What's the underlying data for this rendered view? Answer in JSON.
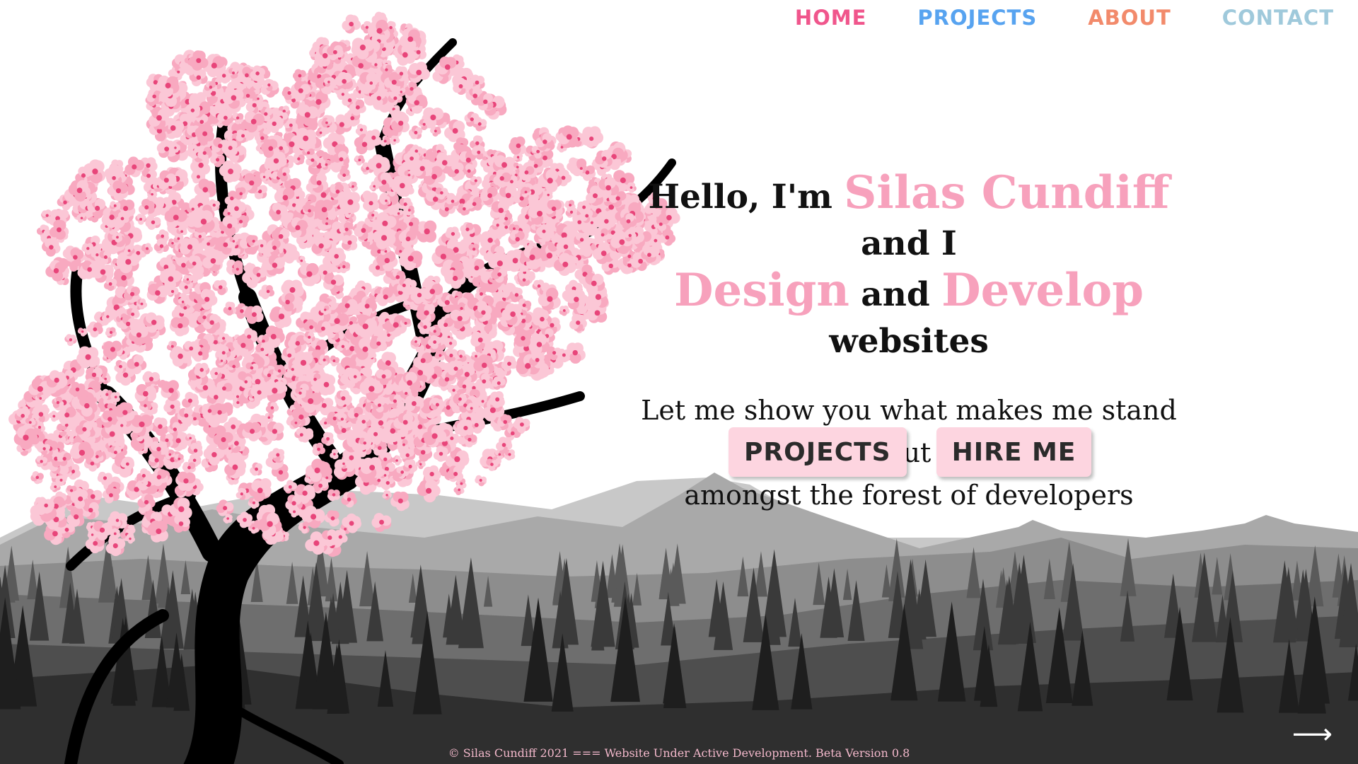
{
  "nav": {
    "items": [
      {
        "label": "HOME",
        "color": "#f0568c"
      },
      {
        "label": "PROJECTS",
        "color": "#57a3f0"
      },
      {
        "label": "ABOUT",
        "color": "#f28a6b"
      },
      {
        "label": "CONTACT",
        "color": "#9fc9db"
      }
    ]
  },
  "hero": {
    "line1_pre": "Hello, I'm ",
    "name": "Silas Cundiff",
    "line1_post": " and I",
    "design": "Design",
    "and": " and ",
    "develop": "Develop",
    "line2_post": " websites",
    "tagline_1": "Let me show you what makes me stand out",
    "tagline_2": "amongst the forest of developers",
    "accent_color": "#f7a1bc"
  },
  "cta": {
    "projects_label": "PROJECTS",
    "hire_label": "HIRE ME",
    "button_color": "#fdd5e0"
  },
  "footer": {
    "text": "© Silas Cundiff 2021 === Website Under Active Development. Beta Version 0.8",
    "color": "#f4b9cc"
  },
  "next_arrow": {
    "icon": "arrow-right-icon",
    "glyph": "⟶"
  }
}
